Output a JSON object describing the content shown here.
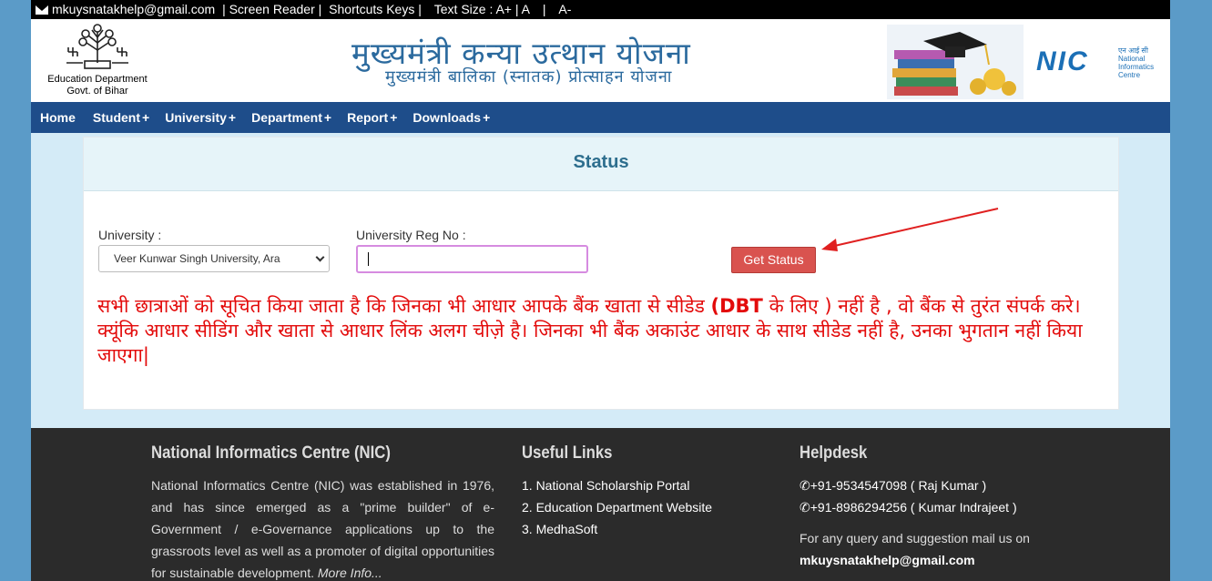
{
  "topbar": {
    "email": "mkuysnatakhelp@gmail.com",
    "screen_reader": "| Screen Reader |",
    "shortcuts": "Shortcuts Keys |",
    "text_size": "Text Size : A+ | A",
    "text_size_sep": "|",
    "text_smaller": "A-"
  },
  "header": {
    "dept_line1": "Education Department",
    "dept_line2": "Govt. of Bihar",
    "title": "मुख्यमंत्री कन्या उत्थान योजना",
    "subtitle": "मुख्यमंत्री बालिका (स्नातक) प्रोत्साहन योजना",
    "nic_logo": "NIC",
    "nic_hindi": "एन आई सी",
    "nic_en1": "National",
    "nic_en2": "Informatics",
    "nic_en3": "Centre"
  },
  "nav": {
    "items": [
      {
        "label": "Home",
        "plus": ""
      },
      {
        "label": "Student",
        "plus": "+"
      },
      {
        "label": "University",
        "plus": "+"
      },
      {
        "label": "Department",
        "plus": "+"
      },
      {
        "label": "Report",
        "plus": "+"
      },
      {
        "label": "Downloads",
        "plus": "+"
      }
    ]
  },
  "panel": {
    "title": "Status",
    "university_label": "University :",
    "university_value": "Veer Kunwar Singh University, Ara",
    "reg_label": "University Reg No :",
    "reg_value": "",
    "button": "Get Status",
    "notice_part1": "सभी छात्राओं को सूचित किया जाता है कि जिनका भी आधार आपके बैंक खाता से सीडेड ",
    "notice_bold": "(DBT",
    "notice_part2": " के लिए ) नहीं है , वो बैंक से तुरंत संपर्क करे। क्यूंकि आधार सीडिंग और खाता से आधार लिंक अलग चीज़े है। जिनका भी बैंक अकाउंट आधार के साथ सीडेड नहीं है, उनका भुगतान नहीं किया जाएगा|"
  },
  "footer": {
    "about_title": "National Informatics Centre (NIC)",
    "about_text": "National Informatics Centre (NIC) was established in 1976, and has since emerged as a \"prime builder\" of e-Government / e-Governance applications up to the grassroots level as well as a promoter of digital opportunities for sustainable development. ",
    "about_more": "More Info...",
    "links_title": "Useful Links",
    "links": [
      "1. National Scholarship Portal",
      "2. Education Department Website",
      "3. MedhaSoft"
    ],
    "help_title": "Helpdesk",
    "phone1": "+91-9534547098 ( Raj Kumar )",
    "phone2": "+91-8986294256 ( Kumar Indrajeet )",
    "query": "For any query and suggestion mail us on",
    "mail": "mkuysnatakhelp@gmail.com"
  },
  "colors": {
    "nav_bg": "#1e4d8a",
    "title": "#2b6a9e",
    "notice": "#e30b0b",
    "button": "#d9534f",
    "footer_bg": "#2b2b2b"
  },
  "icons": [
    "envelope-icon",
    "phone-icon",
    "emblem-logo",
    "books-graduation-image",
    "nic-logo",
    "red-arrow"
  ]
}
